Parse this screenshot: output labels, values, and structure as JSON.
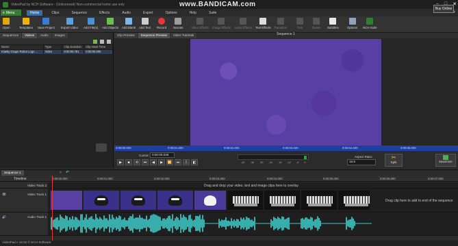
{
  "window": {
    "title": "VideoPad by NCH Software - (Unlicensed) Non-commercial home use only",
    "watermark": "www.BANDICAM.com"
  },
  "menubar": {
    "menu_button": "Menu",
    "items": [
      "Home",
      "Clips",
      "Sequence",
      "Effects",
      "Audio",
      "Export",
      "Options",
      "Help",
      "Suite"
    ]
  },
  "toolbar": {
    "buttons": [
      "Open",
      "Templates",
      "Save Project",
      "Export Video",
      "Add File(s)",
      "Add Objects",
      "Add Blank",
      "Add Text",
      "Record",
      "Narrate",
      "Video Effects",
      "Image Effects",
      "Audio Effects",
      "Text Effects",
      "Transition",
      "Trim",
      "Delete",
      "Subtitles",
      "Options",
      "NCH Suite"
    ],
    "buy_label": "Buy Online"
  },
  "left_panel": {
    "tabs": [
      "Sequences",
      "Videos",
      "Audio",
      "Images"
    ],
    "columns": [
      "Name",
      "Type",
      "Clip Duration",
      "Clip Start Time"
    ],
    "rows": [
      {
        "name": "Klasky Csupo Robot Logo ...",
        "type": "Video",
        "duration": "0:00:05.781",
        "start": "0:00:00.000"
      }
    ]
  },
  "preview": {
    "tabs": [
      "Clip Preview",
      "Sequence Preview",
      "Video Tutorials"
    ],
    "sequence_title": "Sequence 1",
    "time_marks": [
      "0:00:00.000",
      "0:00:01.000",
      "0:00:02.000",
      "0:00:03.000",
      "0:00:04.000",
      "0:00:05.000"
    ],
    "cursor_label": "Cursor:",
    "cursor_value": "0:00:00.036",
    "meter_scale": [
      "-42",
      "-36",
      "-30",
      "-24",
      "-18",
      "-12",
      "-6",
      "0"
    ],
    "aspect_label": "Aspect Ratio:",
    "aspect_value": "16:9",
    "split_label": "Split",
    "maximize_label": "Maximize"
  },
  "timeline": {
    "sequence_tab": "Sequence 1",
    "label": "Timeline",
    "ruler": [
      "0:00:00.000",
      "0:00:01.000",
      "0:00:02.000",
      "0:00:03.000",
      "0:00:04.000",
      "0:00:05.000",
      "0:00:06.000",
      "0:00:07.000"
    ],
    "tracks": {
      "overlay": "Video Track 2",
      "video": "Video Track 1",
      "audio": "Audio Track 1"
    },
    "overlay_hint": "Drag and drop your video, text and image clips here to overlay",
    "end_hint": "Drag clip here to add to end of the sequence"
  },
  "statusbar": {
    "text": "VideoPad v 16.02 © NCH Software"
  },
  "colors": {
    "accent": "#3a6ea5",
    "video_bg": "#5a3fa3",
    "scrub": "#1e3fa0",
    "waveform": "#3fd3d0"
  }
}
